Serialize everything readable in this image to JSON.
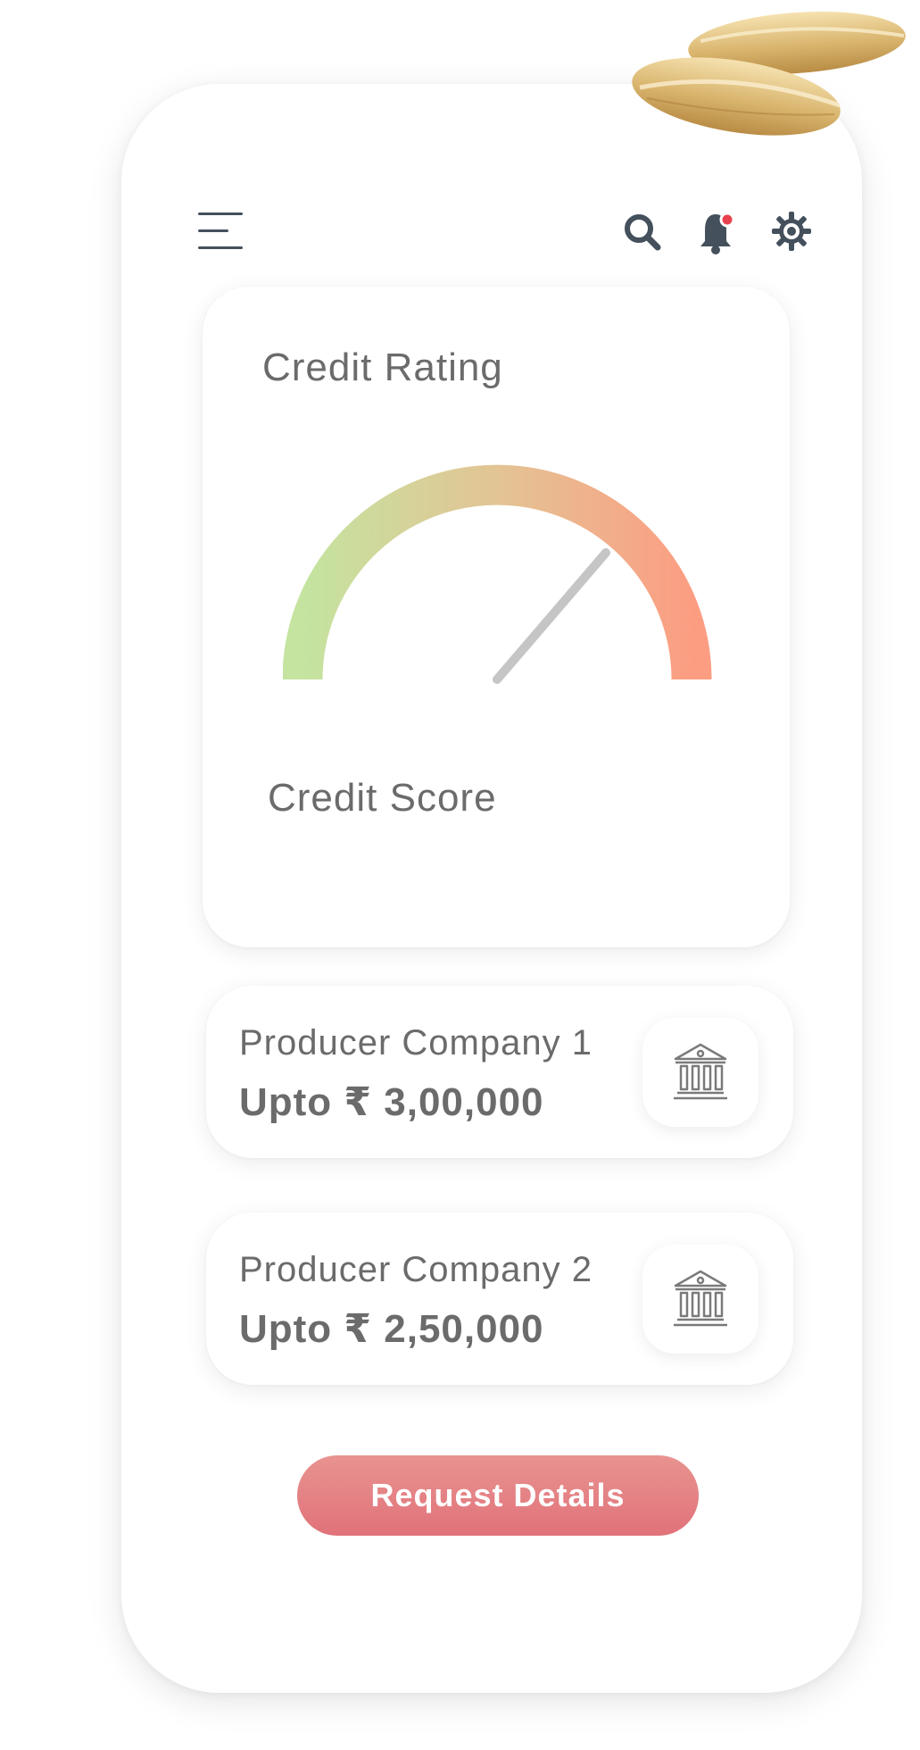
{
  "header": {
    "icons": [
      "menu-icon",
      "search-icon",
      "bell-icon",
      "gear-icon"
    ],
    "notification_dot_color": "#e8414e"
  },
  "credit_rating": {
    "title": "Credit Rating",
    "score_label": "Credit Score",
    "gauge_colors": {
      "low": "#c4e4a0",
      "mid": "#e3c494",
      "high": "#fc9d82"
    },
    "needle_color": "#c5c5c5"
  },
  "companies": [
    {
      "name": "Producer Company 1",
      "amount": "Upto ₹ 3,00,000",
      "icon": "bank-icon"
    },
    {
      "name": "Producer Company 2",
      "amount": "Upto ₹ 2,50,000",
      "icon": "bank-icon"
    }
  ],
  "actions": {
    "request_label": "Request Details",
    "accent_color": "#e27a7e"
  }
}
